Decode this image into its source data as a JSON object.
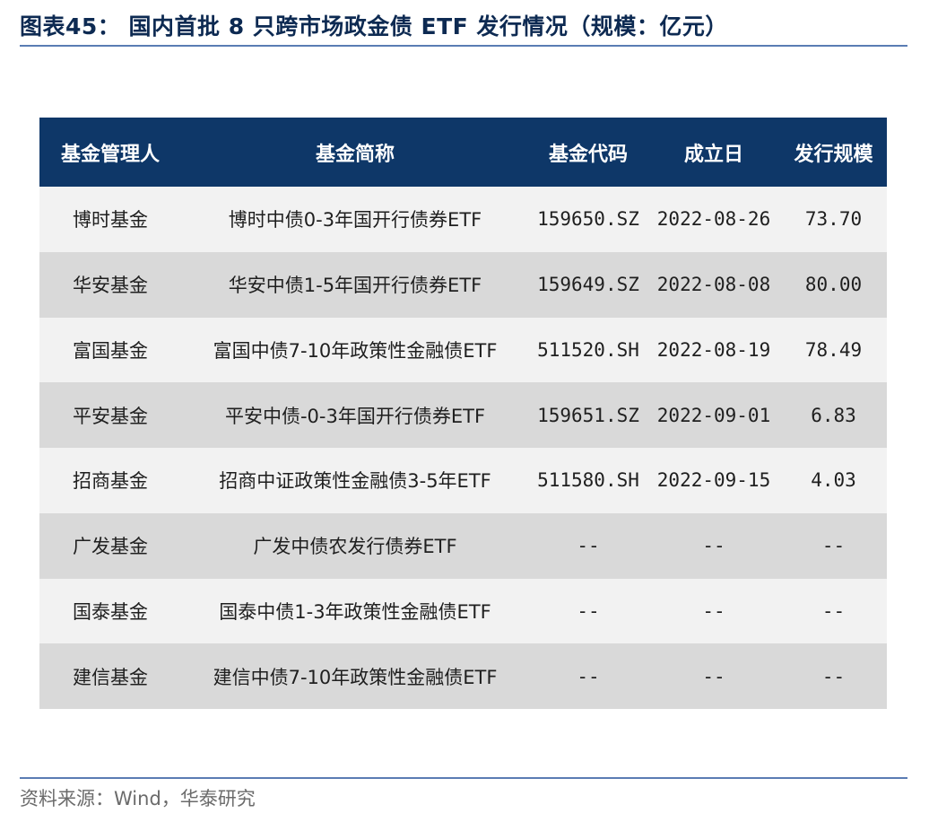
{
  "figure": {
    "title": "图表45： 国内首批 8 只跨市场政金债 ETF 发行情况（规模：亿元）"
  },
  "table": {
    "headers": {
      "manager": "基金管理人",
      "name": "基金简称",
      "code": "基金代码",
      "inception": "成立日",
      "size": "发行规模"
    },
    "rows": [
      {
        "manager": "博时基金",
        "name": "博时中债0-3年国开行债券ETF",
        "code": "159650.SZ",
        "inception": "2022-08-26",
        "size": "73.70"
      },
      {
        "manager": "华安基金",
        "name": "华安中债1-5年国开行债券ETF",
        "code": "159649.SZ",
        "inception": "2022-08-08",
        "size": "80.00"
      },
      {
        "manager": "富国基金",
        "name": "富国中债7-10年政策性金融债ETF",
        "code": "511520.SH",
        "inception": "2022-08-19",
        "size": "78.49"
      },
      {
        "manager": "平安基金",
        "name": "平安中债-0-3年国开行债券ETF",
        "code": "159651.SZ",
        "inception": "2022-09-01",
        "size": "6.83"
      },
      {
        "manager": "招商基金",
        "name": "招商中证政策性金融债3-5年ETF",
        "code": "511580.SH",
        "inception": "2022-09-15",
        "size": "4.03"
      },
      {
        "manager": "广发基金",
        "name": "广发中债农发行债券ETF",
        "code": "--",
        "inception": "--",
        "size": "--"
      },
      {
        "manager": "国泰基金",
        "name": "国泰中债1-3年政策性金融债ETF",
        "code": "--",
        "inception": "--",
        "size": "--"
      },
      {
        "manager": "建信基金",
        "name": "建信中债7-10年政策性金融债ETF",
        "code": "--",
        "inception": "--",
        "size": "--"
      }
    ]
  },
  "source": {
    "text": "资料来源：Wind，华泰研究"
  },
  "colors": {
    "header_bg": "#0e3768",
    "row_light": "#f2f2f2",
    "row_dark": "#d9d9d9",
    "title_text": "#0d2a52",
    "rule": "#5a7cb3"
  }
}
